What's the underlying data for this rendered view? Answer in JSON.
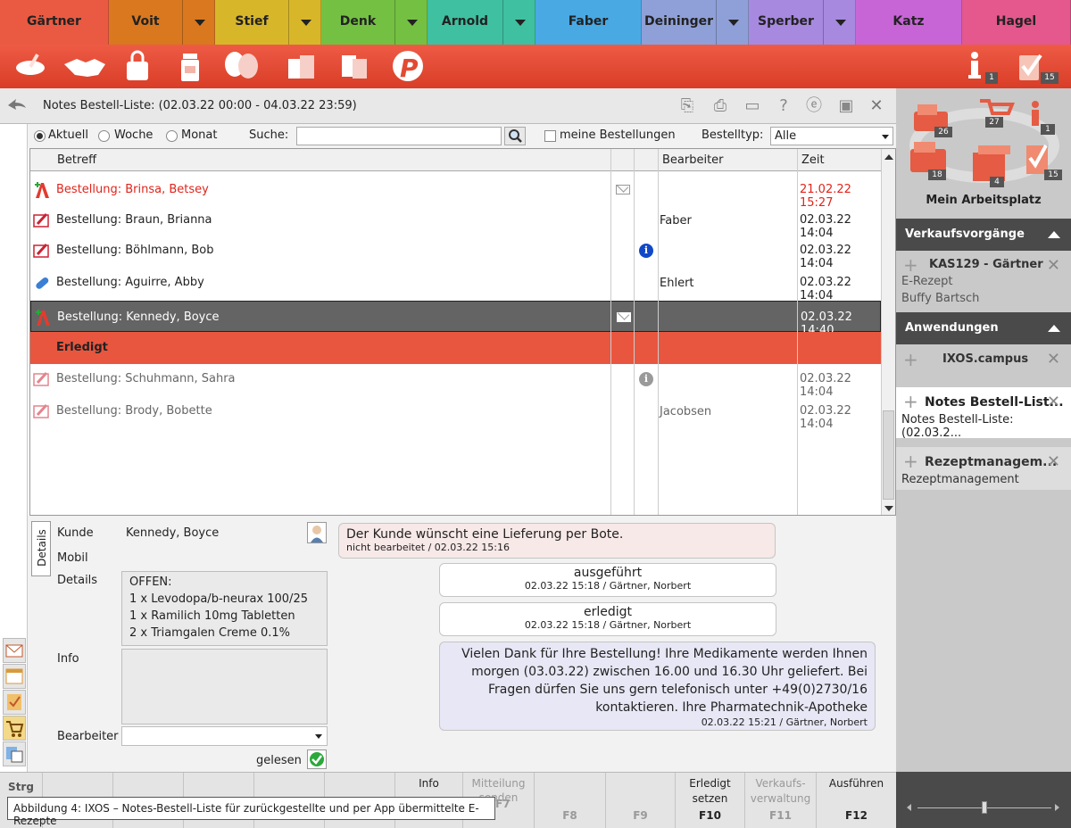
{
  "user_tabs": [
    {
      "name": "Gärtner",
      "color": "#ea5a42",
      "dropdown": false
    },
    {
      "name": "Voit",
      "color": "#d9781f",
      "dropdown": true
    },
    {
      "name": "Stief",
      "color": "#d8b62a",
      "dropdown": true
    },
    {
      "name": "Denk",
      "color": "#74c043",
      "dropdown": true
    },
    {
      "name": "Arnold",
      "color": "#3fc0a0",
      "dropdown": true
    },
    {
      "name": "Faber",
      "color": "#49a9e3",
      "dropdown": false
    },
    {
      "name": "Deininger",
      "color": "#8fa0d8",
      "dropdown": true
    },
    {
      "name": "Sperber",
      "color": "#a789e0",
      "dropdown": true
    },
    {
      "name": "Katz",
      "color": "#c765d7",
      "dropdown": false
    },
    {
      "name": "Hagel",
      "color": "#e4588d",
      "dropdown": false
    }
  ],
  "toolbar": {
    "info_badge": "1",
    "tasks_badge": "15"
  },
  "header": {
    "title": "Notes Bestell-Liste: (02.03.22 00:00 - 04.03.22 23:59)"
  },
  "filter": {
    "radio_current": "Aktuell",
    "radio_week": "Woche",
    "radio_month": "Monat",
    "search_label": "Suche:",
    "my_orders_label": "meine Bestellungen",
    "order_type_label": "Bestelltyp:",
    "order_type_value": "Alle"
  },
  "table": {
    "columns": {
      "subject": "Betreff",
      "clerk": "Bearbeiter",
      "time": "Zeit"
    },
    "rows": [
      {
        "subject": "Bestellung: Brinsa, Betsey",
        "clerk": "",
        "time": "21.02.22 15:27",
        "icon": "a-plus-icon",
        "mail": true,
        "info": false,
        "style": "red"
      },
      {
        "subject": "Bestellung: Braun, Brianna",
        "clerk": "Faber",
        "time": "02.03.22 14:04",
        "icon": "prescription-icon",
        "mail": false,
        "info": false,
        "style": "normal"
      },
      {
        "subject": "Bestellung: Böhlmann, Bob",
        "clerk": "",
        "time": "02.03.22 14:04",
        "icon": "prescription-icon",
        "mail": false,
        "info": true,
        "style": "normal"
      },
      {
        "subject": "Bestellung:  Aguirre, Abby",
        "clerk": "Ehlert",
        "time": "02.03.22 14:04",
        "icon": "pill-icon",
        "mail": false,
        "info": false,
        "style": "normal"
      },
      {
        "subject": "Bestellung: Kennedy, Boyce",
        "clerk": "",
        "time": "02.03.22 14:40",
        "icon": "a-logo-icon",
        "mail": true,
        "info": false,
        "style": "selected"
      },
      {
        "subject": "Erledigt",
        "clerk": "",
        "time": "",
        "icon": "",
        "mail": false,
        "info": false,
        "style": "group"
      },
      {
        "subject": "Bestellung: Schuhmann, Sahra",
        "clerk": "",
        "time": "02.03.22 14:04",
        "icon": "prescription-icon",
        "mail": false,
        "info": true,
        "style": "done"
      },
      {
        "subject": "Bestellung: Brody, Bobette",
        "clerk": "Jacobsen",
        "time": "02.03.22 14:04",
        "icon": "prescription-icon",
        "mail": false,
        "info": false,
        "style": "done"
      }
    ]
  },
  "detail": {
    "tab": "Details",
    "customer_label": "Kunde",
    "customer": "Kennedy, Boyce",
    "mobile_label": "Mobil",
    "details_label": "Details",
    "details_lines": [
      "OFFEN:",
      "1 x Levodopa/b-neurax 100/25",
      "1 x Ramilich 10mg Tabletten",
      "2 x Triamgalen Creme 0.1%"
    ],
    "info_label": "Info",
    "clerk_label": "Bearbeiter",
    "read_label": "gelesen",
    "messages": [
      {
        "text": "Der Kunde wünscht eine Lieferung per Bote.",
        "meta": "nicht bearbeitet / 02.03.22 15:16"
      },
      {
        "text": "ausgeführt",
        "meta": "02.03.22 15:18 / Gärtner, Norbert"
      },
      {
        "text": "erledigt",
        "meta": "02.03.22 15:18 / Gärtner, Norbert"
      },
      {
        "text": "Vielen Dank für Ihre Bestellung! Ihre Medikamente werden Ihnen morgen (03.03.22) zwischen 16.00 und 16.30 Uhr geliefert. Bei Fragen dürfen Sie uns gern telefonisch unter +49(0)2730/16 kontaktieren. Ihre Pharmatechnik-Apotheke",
        "meta": "02.03.22 15:21 / Gärtner, Norbert"
      }
    ]
  },
  "workplace": {
    "title": "Mein Arbeitsplatz",
    "badges": {
      "register": "26",
      "cart": "27",
      "info": "1",
      "cash": "18",
      "packages": "4",
      "tasks": "15"
    }
  },
  "sales": {
    "title": "Verkaufsvorgänge",
    "items": [
      {
        "title": "KAS129 - Gärtner",
        "line1": "E-Rezept",
        "line2": "Buffy Bartsch"
      }
    ]
  },
  "apps": {
    "title": "Anwendungen",
    "items": [
      {
        "title": "IXOS.campus",
        "line1": ""
      },
      {
        "title": "Notes Bestell-List...",
        "line1": "Notes Bestell-Liste: (02.03.2..."
      },
      {
        "title": "Rezeptmanagem...",
        "line1": "Rezeptmanagement"
      }
    ]
  },
  "fkeys": {
    "strg": "Strg",
    "info": "Info",
    "f6_l1": "Mitteilung",
    "f6_l2": "senden",
    "f7": "F7",
    "f8": "F8",
    "f9": "F9",
    "f10_l1": "Erledigt",
    "f10_l2": "setzen",
    "f10": "F10",
    "f11_l1": "Verkaufs-",
    "f11_l2": "verwaltung",
    "f11": "F11",
    "f12_l1": "Ausführen",
    "f12": "F12"
  },
  "caption": "Abbildung 4: IXOS – Notes-Bestell-Liste für zurückgestellte und per App übermittelte E-Rezepte"
}
